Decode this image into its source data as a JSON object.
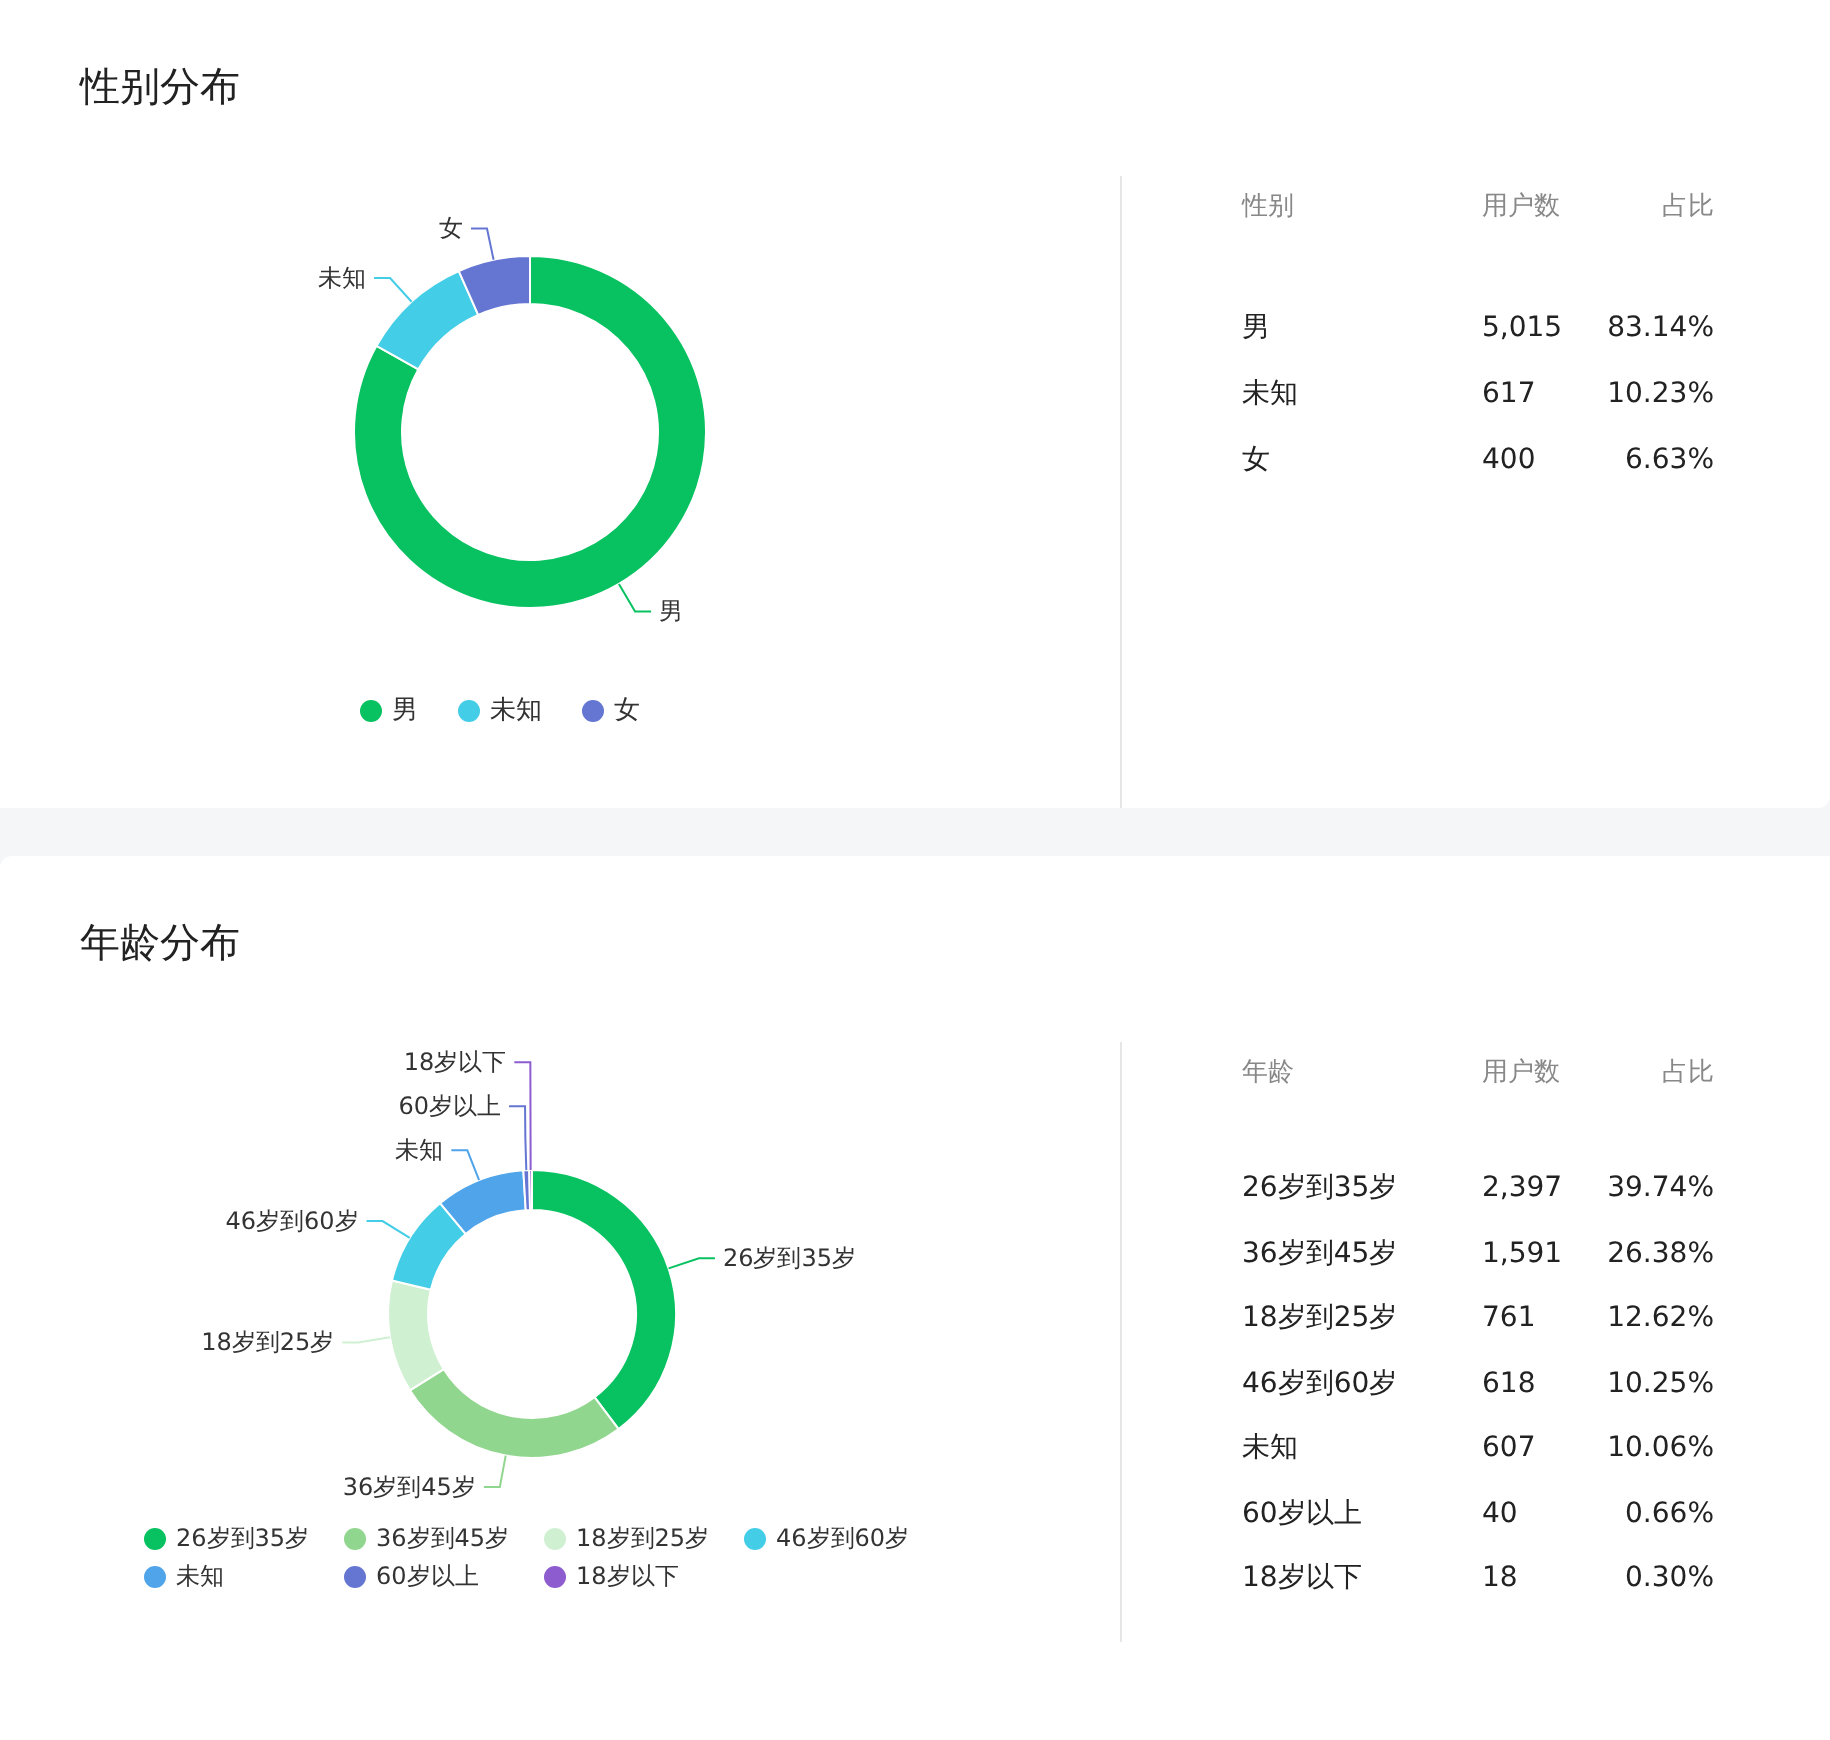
{
  "sections": [
    {
      "title": "性别分布",
      "chart_data": {
        "type": "donut",
        "categories": [
          "男",
          "未知",
          "女"
        ],
        "colors": [
          "#08c160",
          "#43cde6",
          "#6476d2"
        ],
        "values": [
          83.14,
          10.23,
          6.63
        ]
      },
      "legend": [
        {
          "label": "男",
          "color": "#08c160"
        },
        {
          "label": "未知",
          "color": "#43cde6"
        },
        {
          "label": "女",
          "color": "#6476d2"
        }
      ],
      "table": {
        "columns": [
          "性别",
          "用户数",
          "占比"
        ],
        "rows": [
          [
            "男",
            "5,015",
            "83.14%"
          ],
          [
            "未知",
            "617",
            "10.23%"
          ],
          [
            "女",
            "400",
            "6.63%"
          ]
        ]
      }
    },
    {
      "title": "年龄分布",
      "chart_data": {
        "type": "donut",
        "categories": [
          "26岁到35岁",
          "36岁到45岁",
          "18岁到25岁",
          "46岁到60岁",
          "未知",
          "60岁以上",
          "18岁以下"
        ],
        "colors": [
          "#08c160",
          "#91d68e",
          "#d0f0d2",
          "#43cde6",
          "#4fa4ea",
          "#6476d2",
          "#8d5ccf"
        ],
        "values": [
          39.74,
          26.38,
          12.62,
          10.25,
          10.06,
          0.66,
          0.3
        ]
      },
      "legend": [
        {
          "label": "26岁到35岁",
          "color": "#08c160"
        },
        {
          "label": "36岁到45岁",
          "color": "#91d68e"
        },
        {
          "label": "18岁到25岁",
          "color": "#d0f0d2"
        },
        {
          "label": "46岁到60岁",
          "color": "#43cde6"
        },
        {
          "label": "未知",
          "color": "#4fa4ea"
        },
        {
          "label": "60岁以上",
          "color": "#6476d2"
        },
        {
          "label": "18岁以下",
          "color": "#8d5ccf"
        }
      ],
      "table": {
        "columns": [
          "年龄",
          "用户数",
          "占比"
        ],
        "rows": [
          [
            "26岁到35岁",
            "2,397",
            "39.74%"
          ],
          [
            "36岁到45岁",
            "1,591",
            "26.38%"
          ],
          [
            "18岁到25岁",
            "761",
            "12.62%"
          ],
          [
            "46岁到60岁",
            "618",
            "10.25%"
          ],
          [
            "未知",
            "607",
            "10.06%"
          ],
          [
            "60岁以上",
            "40",
            "0.66%"
          ],
          [
            "18岁以下",
            "18",
            "0.30%"
          ]
        ]
      }
    }
  ]
}
